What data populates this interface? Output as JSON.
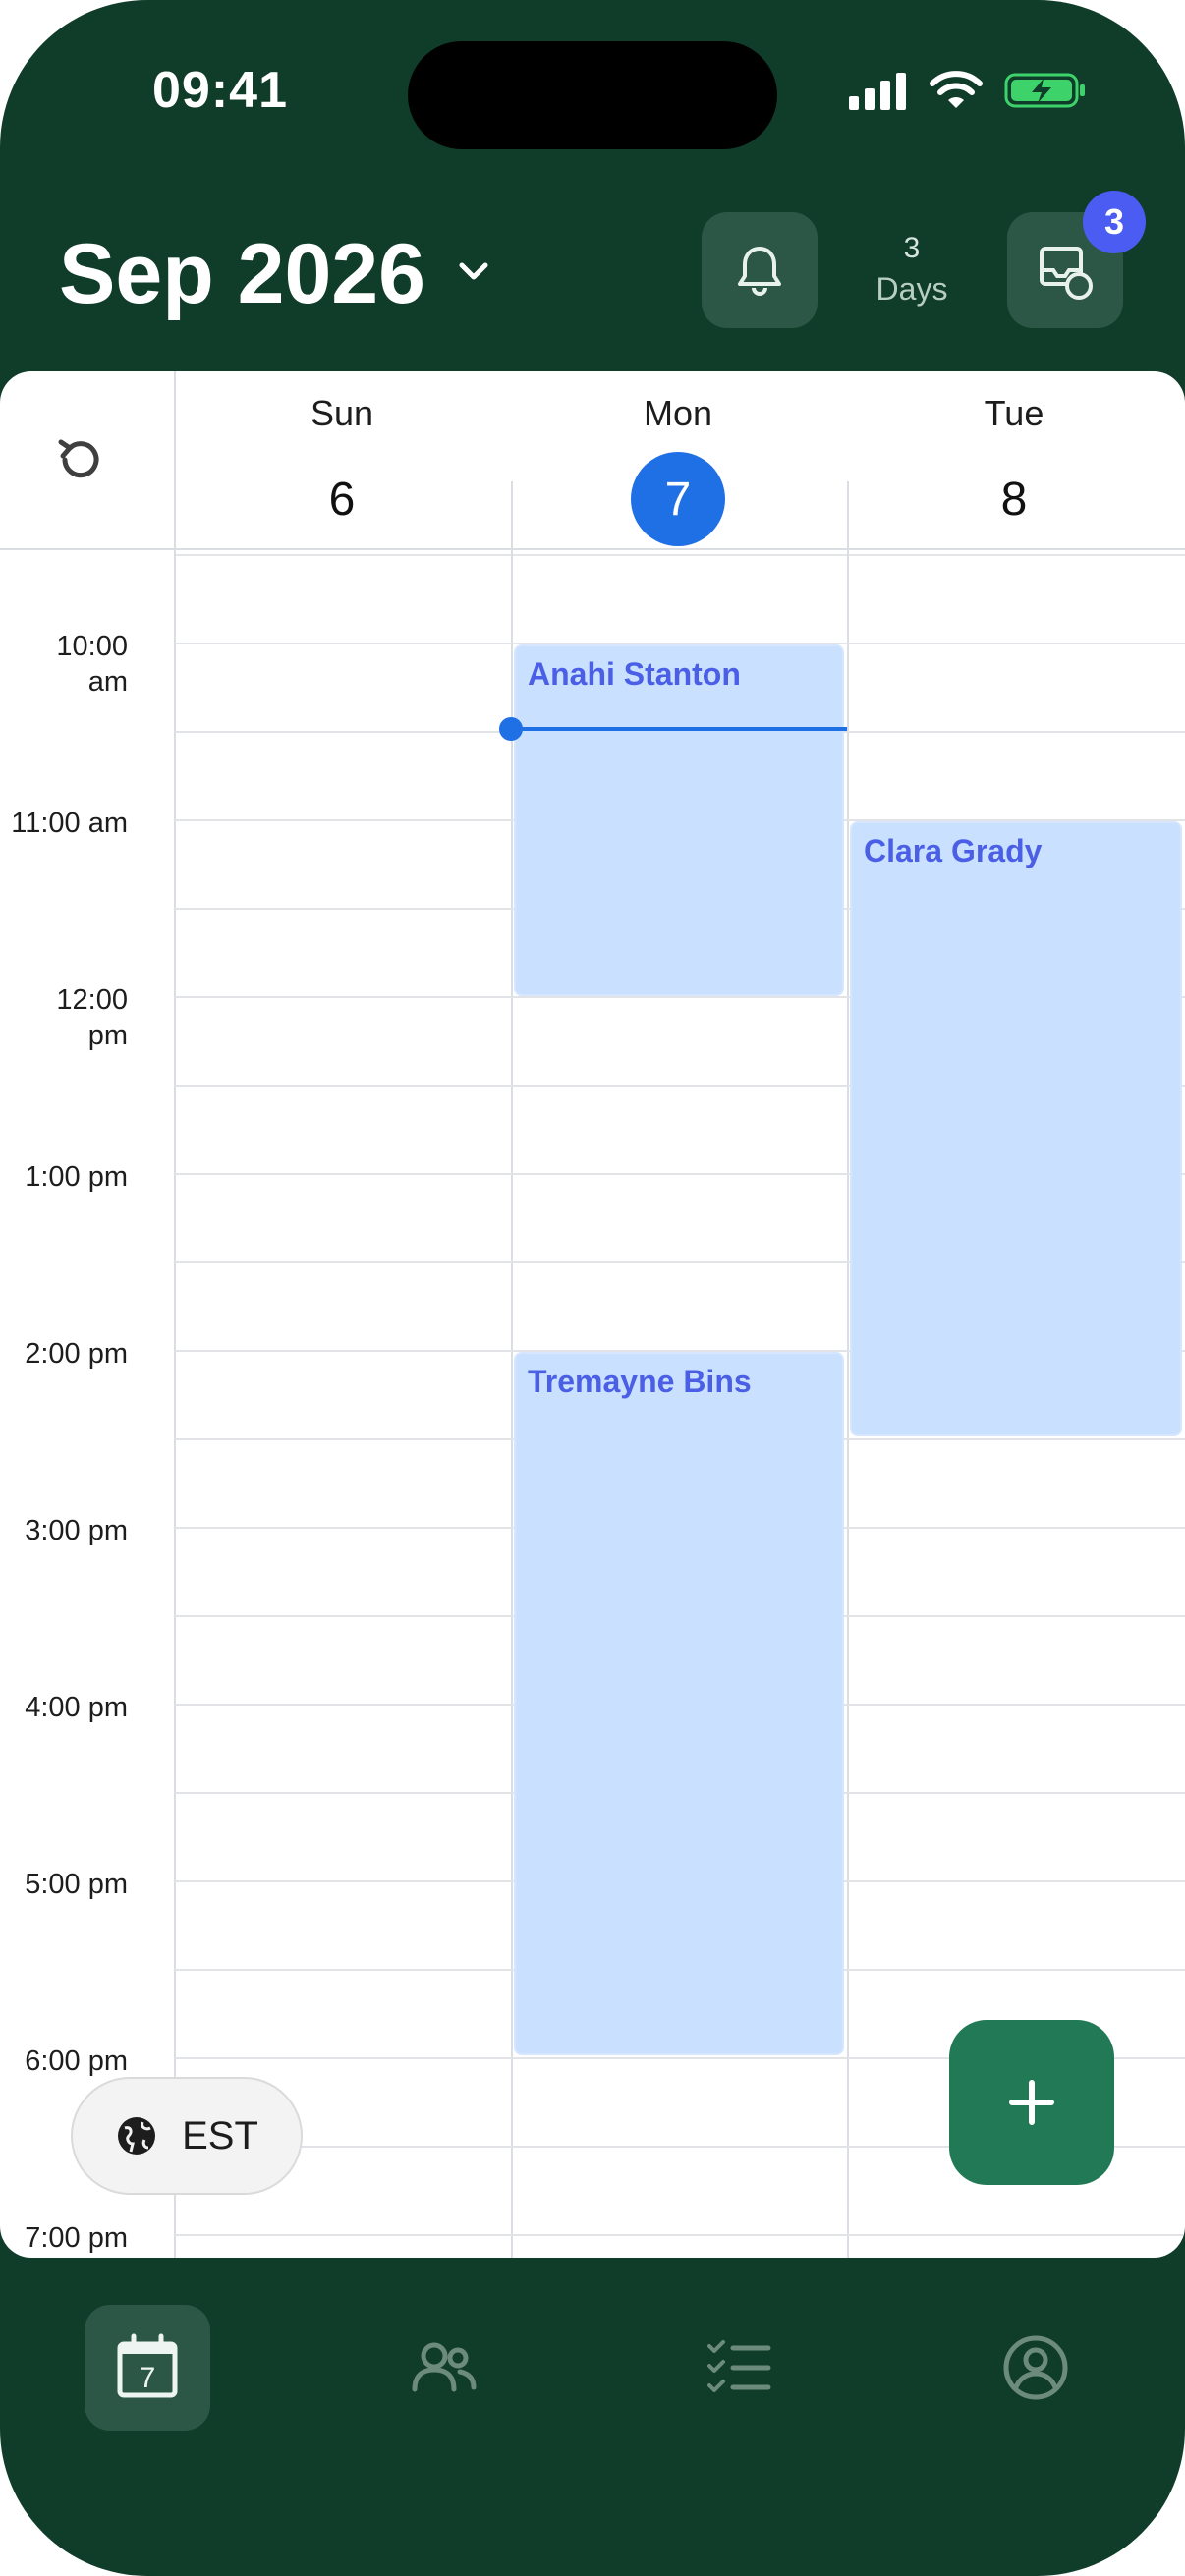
{
  "status_bar": {
    "time": "09:41"
  },
  "header": {
    "month_title": "Sep 2026",
    "days_count": "3",
    "days_label": "Days",
    "inbox_badge": "3"
  },
  "calendar": {
    "days": [
      {
        "name": "Sun",
        "number": "6",
        "today": false
      },
      {
        "name": "Mon",
        "number": "7",
        "today": true
      },
      {
        "name": "Tue",
        "number": "8",
        "today": false
      }
    ],
    "time_labels": [
      {
        "line1": "10:00",
        "line2": "am"
      },
      {
        "line1": "11:00 am",
        "line2": ""
      },
      {
        "line1": "12:00",
        "line2": "pm"
      },
      {
        "line1": "1:00 pm",
        "line2": ""
      },
      {
        "line1": "2:00 pm",
        "line2": ""
      },
      {
        "line1": "3:00 pm",
        "line2": ""
      },
      {
        "line1": "4:00 pm",
        "line2": ""
      },
      {
        "line1": "5:00 pm",
        "line2": ""
      },
      {
        "line1": "6:00 pm",
        "line2": ""
      },
      {
        "line1": "7:00 pm",
        "line2": ""
      }
    ],
    "events": [
      {
        "title": "Anahi Stanton",
        "day": "Mon",
        "start": "10:00 am",
        "end": "12:00 pm"
      },
      {
        "title": "Clara Grady",
        "day": "Tue",
        "start": "11:00 am",
        "end": "2:30 pm"
      },
      {
        "title": "Tremayne Bins",
        "day": "Mon",
        "start": "2:00 pm",
        "end": "6:00 pm"
      }
    ],
    "timezone": "EST"
  },
  "colors": {
    "brand_dark": "#103c2a",
    "accent_blue": "#1f6fe5",
    "event_fill": "#cae0ff",
    "event_text": "#4a5fe6",
    "fab": "#217a55",
    "badge": "#4b5cf2"
  },
  "nav": {
    "items": [
      {
        "icon": "calendar-icon",
        "active": true,
        "badge_text": "7"
      },
      {
        "icon": "people-icon",
        "active": false
      },
      {
        "icon": "tasks-icon",
        "active": false
      },
      {
        "icon": "profile-icon",
        "active": false
      }
    ]
  }
}
